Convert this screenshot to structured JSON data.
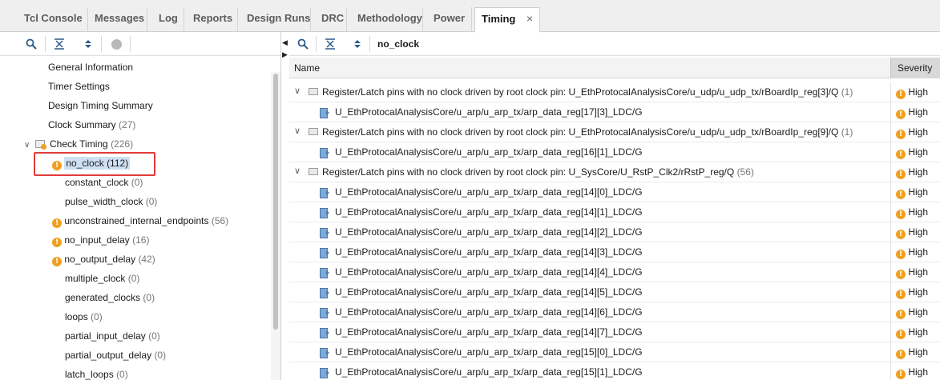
{
  "tabs": [
    {
      "label": "Tcl Console"
    },
    {
      "label": "Messages"
    },
    {
      "label": "Log"
    },
    {
      "label": "Reports"
    },
    {
      "label": "Design Runs"
    },
    {
      "label": "DRC"
    },
    {
      "label": "Methodology"
    },
    {
      "label": "Power"
    },
    {
      "label": "Timing",
      "active": true
    }
  ],
  "tab_close": "×",
  "left_tree": [
    {
      "label": "General Information",
      "count": ""
    },
    {
      "label": "Timer Settings",
      "count": ""
    },
    {
      "label": "Design Timing Summary",
      "count": ""
    },
    {
      "label": "Clock Summary",
      "count": "(27)"
    },
    {
      "label": "Check Timing",
      "count": "(226)"
    },
    {
      "label": "no_clock",
      "count": "(112)"
    },
    {
      "label": "constant_clock",
      "count": "(0)"
    },
    {
      "label": "pulse_width_clock",
      "count": "(0)"
    },
    {
      "label": "unconstrained_internal_endpoints",
      "count": "(56)"
    },
    {
      "label": "no_input_delay",
      "count": "(16)"
    },
    {
      "label": "no_output_delay",
      "count": "(42)"
    },
    {
      "label": "multiple_clock",
      "count": "(0)"
    },
    {
      "label": "generated_clocks",
      "count": "(0)"
    },
    {
      "label": "loops",
      "count": "(0)"
    },
    {
      "label": "partial_input_delay",
      "count": "(0)"
    },
    {
      "label": "partial_output_delay",
      "count": "(0)"
    },
    {
      "label": "latch_loops",
      "count": "(0)"
    }
  ],
  "right_title": "no_clock",
  "columns": {
    "name": "Name",
    "severity": "Severity"
  },
  "rows": [
    {
      "type": "group",
      "text": "Register/Latch pins with no clock driven by root clock pin: U_EthProtocalAnalysisCore/u_udp/u_udp_tx/rBoardIp_reg[3]/Q",
      "count": "(1)",
      "severity": "High"
    },
    {
      "type": "item",
      "text": "U_EthProtocalAnalysisCore/u_arp/u_arp_tx/arp_data_reg[17][3]_LDC/G",
      "severity": "High"
    },
    {
      "type": "group",
      "text": "Register/Latch pins with no clock driven by root clock pin: U_EthProtocalAnalysisCore/u_udp/u_udp_tx/rBoardIp_reg[9]/Q",
      "count": "(1)",
      "severity": "High"
    },
    {
      "type": "item",
      "text": "U_EthProtocalAnalysisCore/u_arp/u_arp_tx/arp_data_reg[16][1]_LDC/G",
      "severity": "High"
    },
    {
      "type": "group",
      "text": "Register/Latch pins with no clock driven by root clock pin: U_SysCore/U_RstP_Clk2/rRstP_reg/Q",
      "count": "(56)",
      "severity": "High"
    },
    {
      "type": "item",
      "text": "U_EthProtocalAnalysisCore/u_arp/u_arp_tx/arp_data_reg[14][0]_LDC/G",
      "severity": "High"
    },
    {
      "type": "item",
      "text": "U_EthProtocalAnalysisCore/u_arp/u_arp_tx/arp_data_reg[14][1]_LDC/G",
      "severity": "High"
    },
    {
      "type": "item",
      "text": "U_EthProtocalAnalysisCore/u_arp/u_arp_tx/arp_data_reg[14][2]_LDC/G",
      "severity": "High"
    },
    {
      "type": "item",
      "text": "U_EthProtocalAnalysisCore/u_arp/u_arp_tx/arp_data_reg[14][3]_LDC/G",
      "severity": "High"
    },
    {
      "type": "item",
      "text": "U_EthProtocalAnalysisCore/u_arp/u_arp_tx/arp_data_reg[14][4]_LDC/G",
      "severity": "High"
    },
    {
      "type": "item",
      "text": "U_EthProtocalAnalysisCore/u_arp/u_arp_tx/arp_data_reg[14][5]_LDC/G",
      "severity": "High"
    },
    {
      "type": "item",
      "text": "U_EthProtocalAnalysisCore/u_arp/u_arp_tx/arp_data_reg[14][6]_LDC/G",
      "severity": "High"
    },
    {
      "type": "item",
      "text": "U_EthProtocalAnalysisCore/u_arp/u_arp_tx/arp_data_reg[14][7]_LDC/G",
      "severity": "High"
    },
    {
      "type": "item",
      "text": "U_EthProtocalAnalysisCore/u_arp/u_arp_tx/arp_data_reg[15][0]_LDC/G",
      "severity": "High"
    },
    {
      "type": "item",
      "text": "U_EthProtocalAnalysisCore/u_arp/u_arp_tx/arp_data_reg[15][1]_LDC/G",
      "severity": "High"
    }
  ],
  "colors": {
    "accent": "#2b5a8a",
    "warning": "#f0a020",
    "highlight_box": "#e23b3b",
    "selection": "#cfe0f5"
  }
}
